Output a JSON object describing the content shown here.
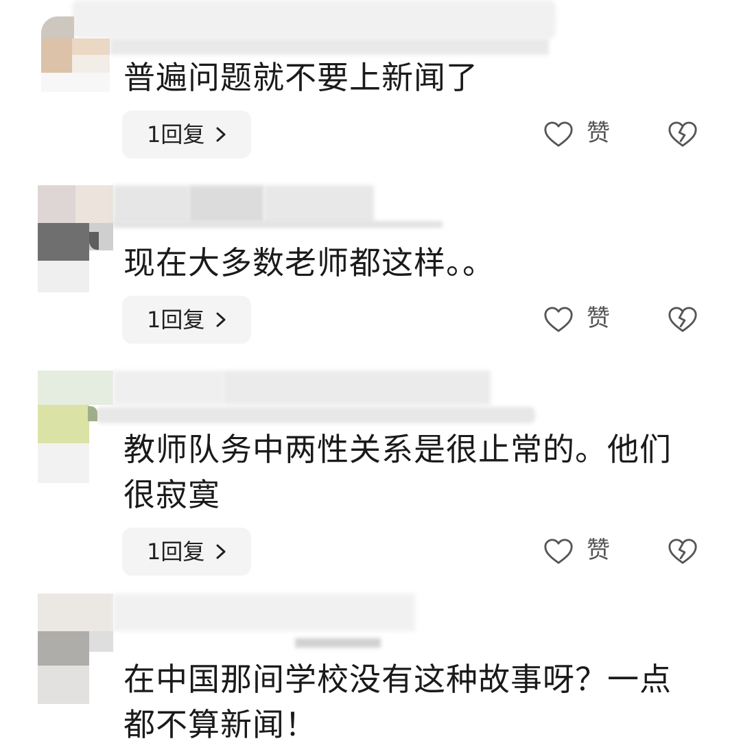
{
  "colors": {
    "text": "#1a1a1a",
    "icon": "#555555",
    "reply_button_bg": "#f4f4f4",
    "background": "#ffffff"
  },
  "icons": {
    "like": "heart-outline-icon",
    "dislike": "broken-heart-icon",
    "reply_arrow": "chevron-right-icon"
  },
  "comments": [
    {
      "text_lines": [
        "普遍问题就不要上新闻了"
      ],
      "reply_label": "1回复",
      "like_label": "赞"
    },
    {
      "text_lines": [
        "现在大多数老师都这样。。"
      ],
      "reply_label": "1回复",
      "like_label": "赞"
    },
    {
      "text_lines": [
        "教师队务中两性关系是很止常的。他们",
        "很寂寞"
      ],
      "reply_label": "1回复",
      "like_label": "赞"
    },
    {
      "text_lines": [
        "在中国那间学校没有这种故事呀？一点",
        "都不算新闻！"
      ]
    }
  ]
}
